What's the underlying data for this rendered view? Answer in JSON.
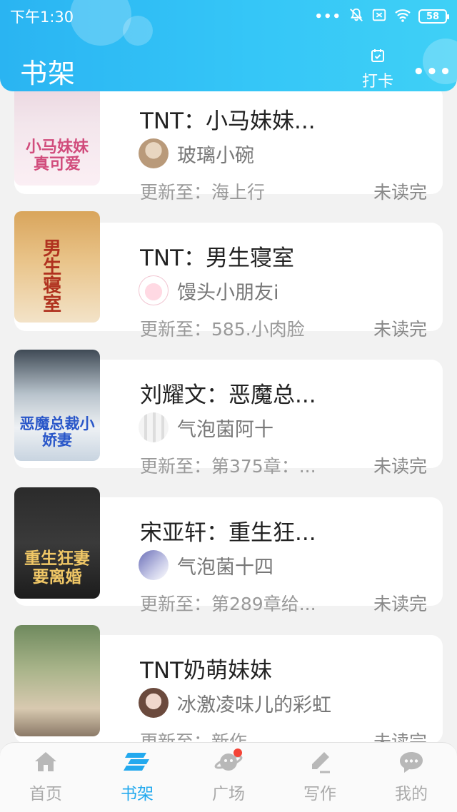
{
  "status_bar": {
    "time": "下午1:30",
    "dots": "•••",
    "battery": "58"
  },
  "header": {
    "title": "书架",
    "checkin_label": "打卡",
    "more_label": "•••"
  },
  "books": [
    {
      "title": "TNT：小马妹妹...",
      "author": "玻璃小碗",
      "update": "更新至：海上行",
      "status": "未读完",
      "cover_text": "小马妹妹真可爱"
    },
    {
      "title": "TNT：男生寝室",
      "author": "馒头小朋友i",
      "update": "更新至：585.小肉脸",
      "status": "未读完",
      "cover_text": "男生寝室"
    },
    {
      "title": "刘耀文：恶魔总...",
      "author": "气泡菌阿十",
      "update": "更新至：第375章：...",
      "status": "未读完",
      "cover_text": "恶魔总裁小娇妻"
    },
    {
      "title": "宋亚轩：重生狂...",
      "author": "气泡菌十四",
      "update": "更新至：第289章给...",
      "status": "未读完",
      "cover_text": "重生狂妻要离婚"
    },
    {
      "title": "TNT奶萌妹妹",
      "author": "冰激凌味儿的彩虹",
      "update": "更新至：新作",
      "status": "未读完",
      "cover_text": ""
    }
  ],
  "nav": {
    "items": [
      {
        "label": "首页",
        "icon": "home-icon"
      },
      {
        "label": "书架",
        "icon": "bookshelf-icon"
      },
      {
        "label": "广场",
        "icon": "planet-icon"
      },
      {
        "label": "写作",
        "icon": "pen-icon"
      },
      {
        "label": "我的",
        "icon": "chat-icon"
      }
    ],
    "active_index": 1
  },
  "colors": {
    "header_start": "#2ab4f2",
    "header_end": "#3fd0f6",
    "active_nav": "#23a9ee",
    "badge": "#f44336"
  }
}
